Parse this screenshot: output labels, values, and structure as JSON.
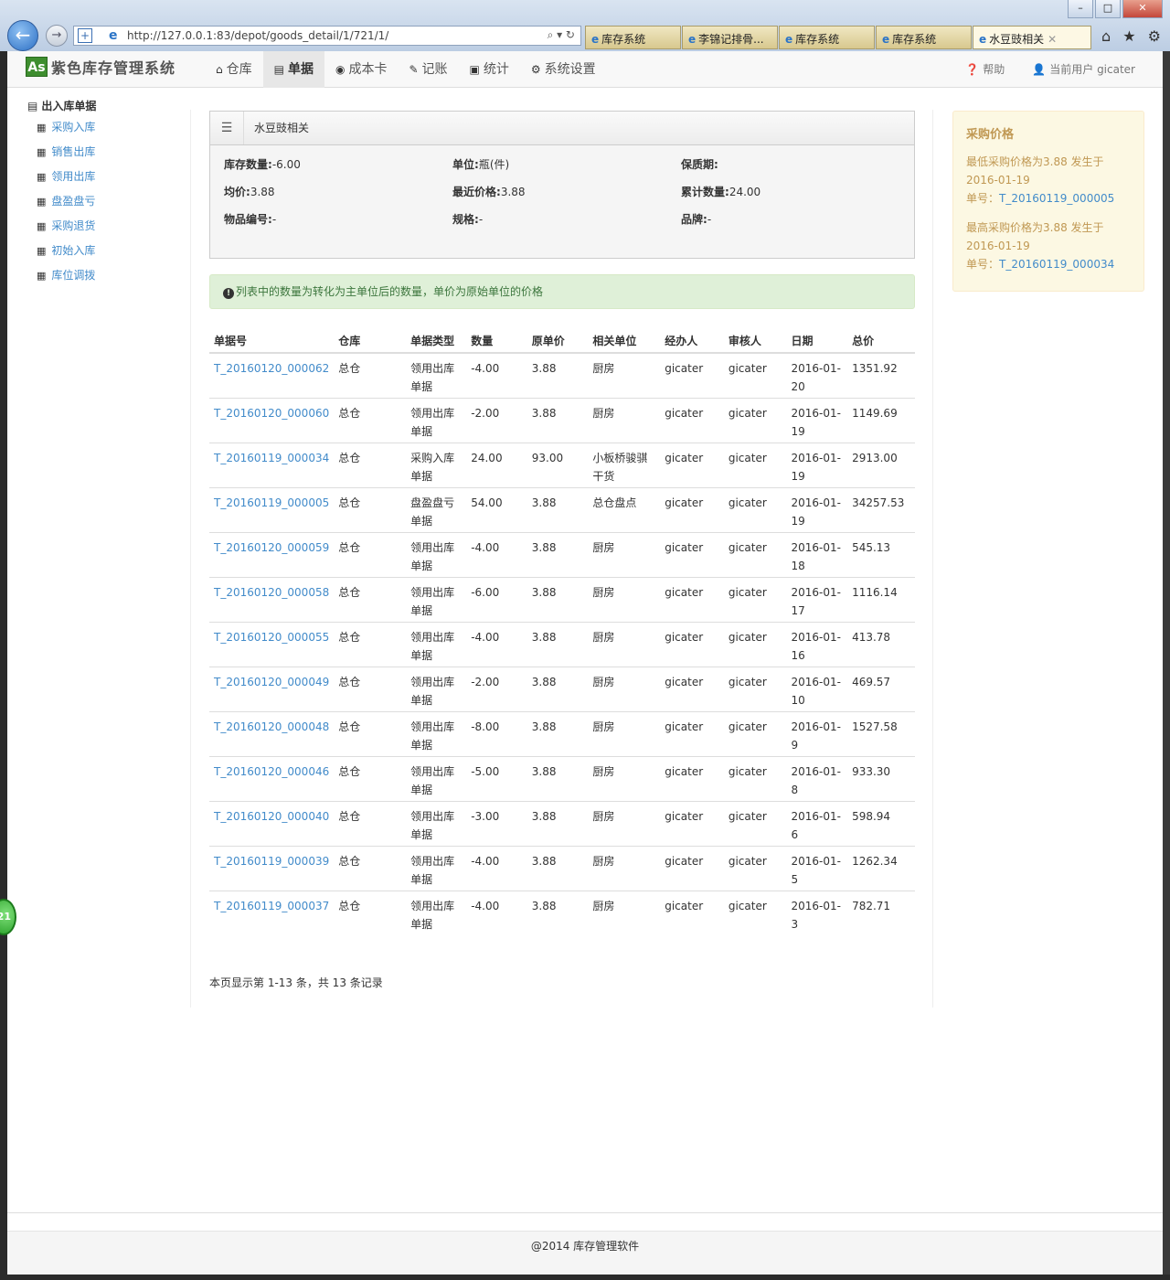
{
  "browser": {
    "url": "http://127.0.0.1:83/depot/goods_detail/1/721/1/",
    "tabs": [
      {
        "label": "库存系统",
        "active": false
      },
      {
        "label": "李锦记排骨...",
        "active": false
      },
      {
        "label": "库存系统",
        "active": false
      },
      {
        "label": "库存系统",
        "active": false
      },
      {
        "label": "水豆豉相关",
        "active": true
      }
    ]
  },
  "navbar": {
    "brand_logo": "As",
    "brand": "紫色库存管理系统",
    "menu": [
      {
        "label": "仓库",
        "icon": "home-icon",
        "glyph": "⌂"
      },
      {
        "label": "单据",
        "icon": "list-icon",
        "glyph": "▤"
      },
      {
        "label": "成本卡",
        "icon": "eye-icon",
        "glyph": "◉"
      },
      {
        "label": "记账",
        "icon": "pencil-icon",
        "glyph": "✎"
      },
      {
        "label": "统计",
        "icon": "picture-icon",
        "glyph": "▣"
      },
      {
        "label": "系统设置",
        "icon": "gear-icon",
        "glyph": "⚙"
      }
    ],
    "help": "帮助",
    "user": "当前用户 gicater"
  },
  "sidebar": {
    "title": "出入库单据",
    "items": [
      "采购入库",
      "销售出库",
      "领用出库",
      "盘盈盘亏",
      "采购退货",
      "初始入库",
      "库位调拨"
    ]
  },
  "panel": {
    "title": "水豆豉相关",
    "rows": [
      [
        {
          "label": "库存数量:",
          "value": "-6.00"
        },
        {
          "label": "单位:",
          "value": "瓶(件)"
        },
        {
          "label": "保质期:",
          "value": ""
        }
      ],
      [
        {
          "label": "均价:",
          "value": "3.88"
        },
        {
          "label": "最近价格:",
          "value": "3.88"
        },
        {
          "label": "累计数量:",
          "value": "24.00"
        }
      ],
      [
        {
          "label": "物品编号:",
          "value": "-"
        },
        {
          "label": "规格:",
          "value": "-"
        },
        {
          "label": "品牌:",
          "value": "-"
        }
      ]
    ]
  },
  "alert": "列表中的数量为转化为主单位后的数量，单价为原始单位的价格",
  "table": {
    "headers": [
      "单据号",
      "仓库",
      "单据类型",
      "数量",
      "原单价",
      "相关单位",
      "经办人",
      "审核人",
      "日期",
      "总价"
    ],
    "rows": [
      [
        "T_20160120_000062",
        "总仓",
        "领用出库单据",
        "-4.00",
        "3.88",
        "厨房",
        "gicater",
        "gicater",
        "2016-01-20",
        "1351.92"
      ],
      [
        "T_20160120_000060",
        "总仓",
        "领用出库单据",
        "-2.00",
        "3.88",
        "厨房",
        "gicater",
        "gicater",
        "2016-01-19",
        "1149.69"
      ],
      [
        "T_20160119_000034",
        "总仓",
        "采购入库单据",
        "24.00",
        "93.00",
        "小板桥骏骐干货",
        "gicater",
        "gicater",
        "2016-01-19",
        "2913.00"
      ],
      [
        "T_20160119_000005",
        "总仓",
        "盘盈盘亏单据",
        "54.00",
        "3.88",
        "总仓盘点",
        "gicater",
        "gicater",
        "2016-01-19",
        "34257.53"
      ],
      [
        "T_20160120_000059",
        "总仓",
        "领用出库单据",
        "-4.00",
        "3.88",
        "厨房",
        "gicater",
        "gicater",
        "2016-01-18",
        "545.13"
      ],
      [
        "T_20160120_000058",
        "总仓",
        "领用出库单据",
        "-6.00",
        "3.88",
        "厨房",
        "gicater",
        "gicater",
        "2016-01-17",
        "1116.14"
      ],
      [
        "T_20160120_000055",
        "总仓",
        "领用出库单据",
        "-4.00",
        "3.88",
        "厨房",
        "gicater",
        "gicater",
        "2016-01-16",
        "413.78"
      ],
      [
        "T_20160120_000049",
        "总仓",
        "领用出库单据",
        "-2.00",
        "3.88",
        "厨房",
        "gicater",
        "gicater",
        "2016-01-10",
        "469.57"
      ],
      [
        "T_20160120_000048",
        "总仓",
        "领用出库单据",
        "-8.00",
        "3.88",
        "厨房",
        "gicater",
        "gicater",
        "2016-01-9",
        "1527.58"
      ],
      [
        "T_20160120_000046",
        "总仓",
        "领用出库单据",
        "-5.00",
        "3.88",
        "厨房",
        "gicater",
        "gicater",
        "2016-01-8",
        "933.30"
      ],
      [
        "T_20160120_000040",
        "总仓",
        "领用出库单据",
        "-3.00",
        "3.88",
        "厨房",
        "gicater",
        "gicater",
        "2016-01-6",
        "598.94"
      ],
      [
        "T_20160119_000039",
        "总仓",
        "领用出库单据",
        "-4.00",
        "3.88",
        "厨房",
        "gicater",
        "gicater",
        "2016-01-5",
        "1262.34"
      ],
      [
        "T_20160119_000037",
        "总仓",
        "领用出库单据",
        "-4.00",
        "3.88",
        "厨房",
        "gicater",
        "gicater",
        "2016-01-3",
        "782.71"
      ]
    ]
  },
  "pager": "本页显示第 1-13 条，共 13 条记录",
  "pricebox": {
    "title": "采购价格",
    "min_text": "最低采购价格为3.88 发生于2016-01-19",
    "min_no_label": "单号：",
    "min_no": "T_20160119_000005",
    "max_text": "最高采购价格为3.88 发生于2016-01-19",
    "max_no_label": "单号：",
    "max_no": "T_20160119_000034"
  },
  "footer": "@2014 库存管理软件",
  "badge": "21"
}
